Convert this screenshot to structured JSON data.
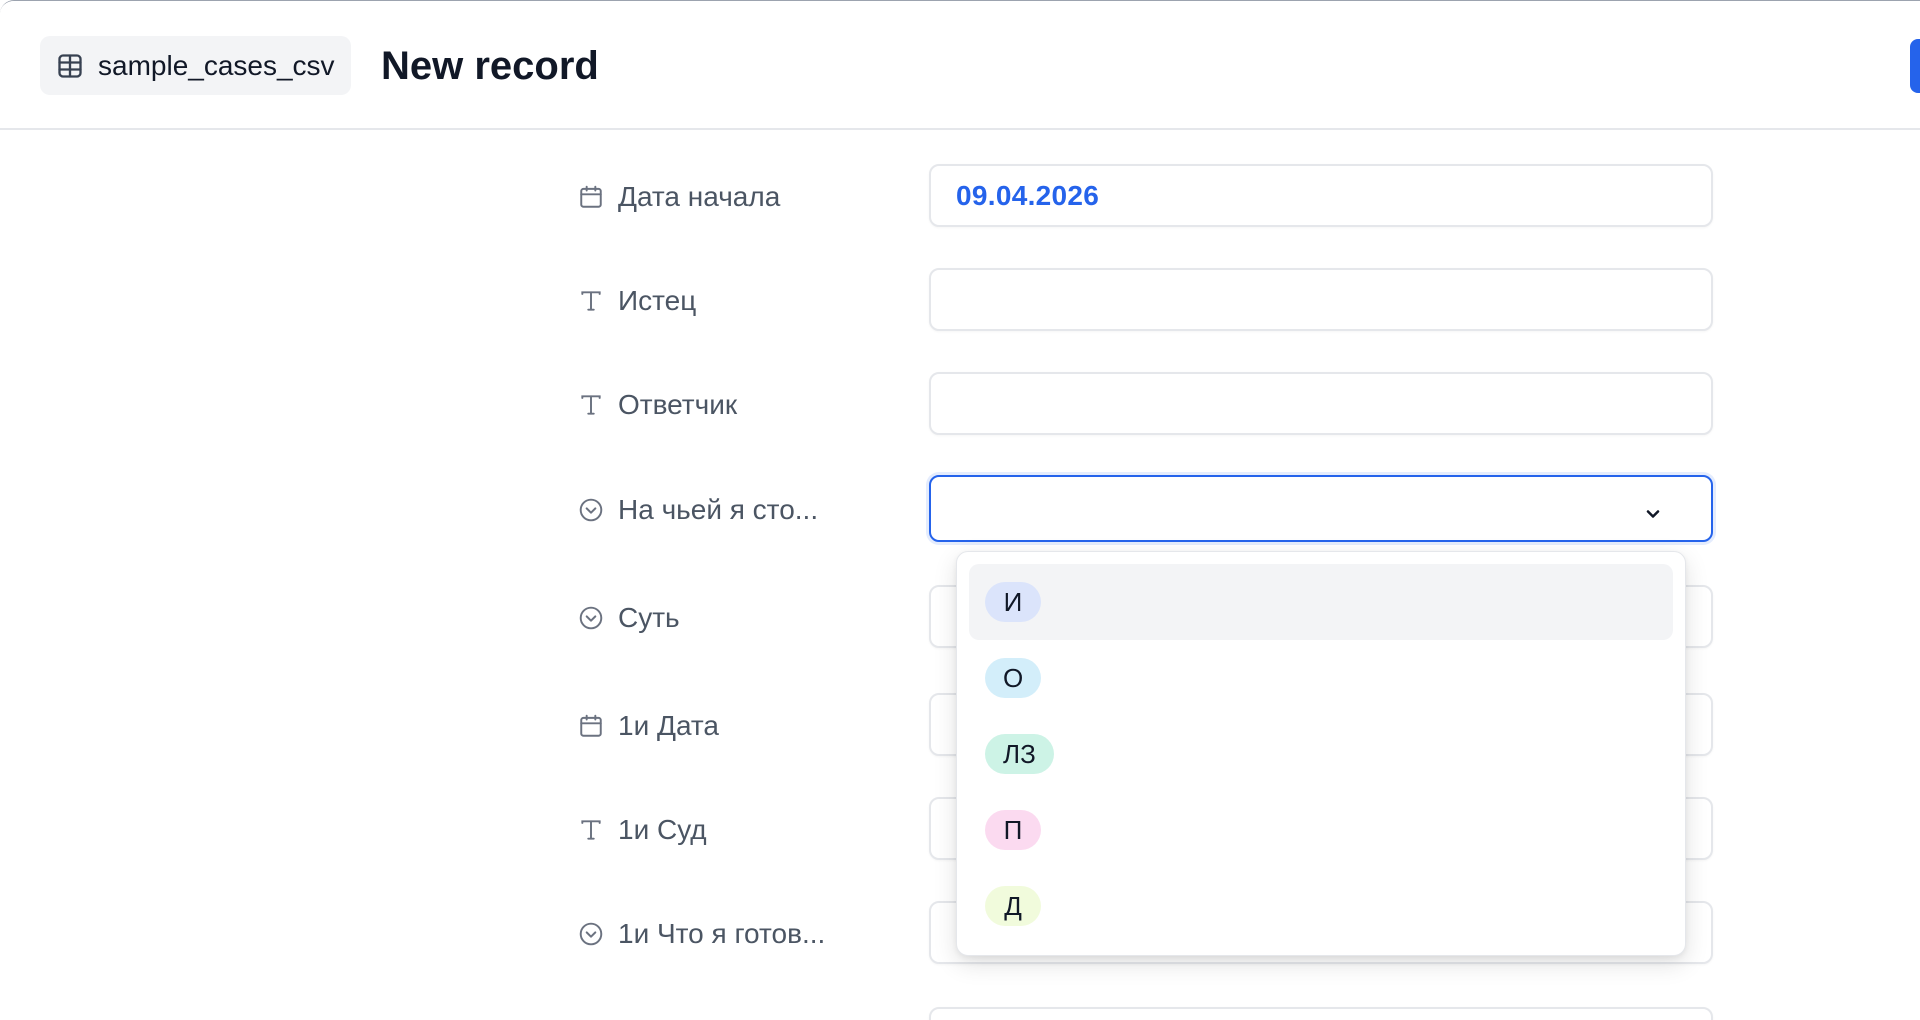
{
  "header": {
    "table_name": "sample_cases_csv",
    "title": "New record"
  },
  "fields": [
    {
      "label": "Дата начала",
      "type": "date",
      "value": "09.04.2026"
    },
    {
      "label": "Истец",
      "type": "text",
      "value": ""
    },
    {
      "label": "Ответчик",
      "type": "text",
      "value": ""
    },
    {
      "label": "На чьей я сто...",
      "type": "select",
      "value": ""
    },
    {
      "label": "Суть",
      "type": "select",
      "value": ""
    },
    {
      "label": "1и Дата",
      "type": "date",
      "value": ""
    },
    {
      "label": "1и Суд",
      "type": "text",
      "value": ""
    },
    {
      "label": "1и Что я готов...",
      "type": "select",
      "value": ""
    }
  ],
  "dropdown": {
    "options": [
      {
        "label": "И",
        "color": "#dbe4fb"
      },
      {
        "label": "О",
        "color": "#d3eefa"
      },
      {
        "label": "ЛЗ",
        "color": "#cdf3e6"
      },
      {
        "label": "П",
        "color": "#fbdaf0"
      },
      {
        "label": "Д",
        "color": "#f1fbdc"
      }
    ],
    "hovered_index": 0
  },
  "colors": {
    "accent": "#2563eb",
    "border": "#e5e7eb",
    "label": "#4b5563"
  }
}
